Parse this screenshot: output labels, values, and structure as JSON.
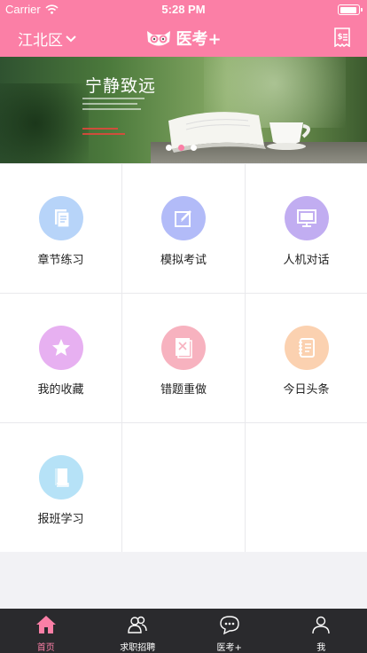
{
  "status_bar": {
    "carrier": "Carrier",
    "time": "5:28 PM"
  },
  "nav": {
    "city": "江北区",
    "brand": "医考+"
  },
  "banner": {
    "slogan": "宁静致远",
    "slide_count": 3,
    "active_slide": 2
  },
  "grid": [
    {
      "label": "章节练习",
      "icon": "document-icon",
      "color": "#b7d4f9"
    },
    {
      "label": "模拟考试",
      "icon": "edit-icon",
      "color": "#b2bbf8"
    },
    {
      "label": "人机对话",
      "icon": "monitor-icon",
      "color": "#c1adf1"
    },
    {
      "label": "我的收藏",
      "icon": "star-icon",
      "color": "#e7b0f1"
    },
    {
      "label": "错题重做",
      "icon": "wrong-paper-icon",
      "color": "#f7b2bf"
    },
    {
      "label": "今日头条",
      "icon": "notebook-icon",
      "color": "#fbd1b0"
    },
    {
      "label": "报班学习",
      "icon": "book-icon",
      "color": "#b6e2f7"
    }
  ],
  "tabs": [
    {
      "label": "首页",
      "icon": "home-icon",
      "active": true
    },
    {
      "label": "求职招聘",
      "icon": "people-icon",
      "active": false
    },
    {
      "label": "医考+",
      "icon": "chat-icon",
      "active": false
    },
    {
      "label": "我",
      "icon": "person-icon",
      "active": false
    }
  ],
  "colors": {
    "brand": "#fb7fa6",
    "tab_bar": "#2a2a2d"
  }
}
